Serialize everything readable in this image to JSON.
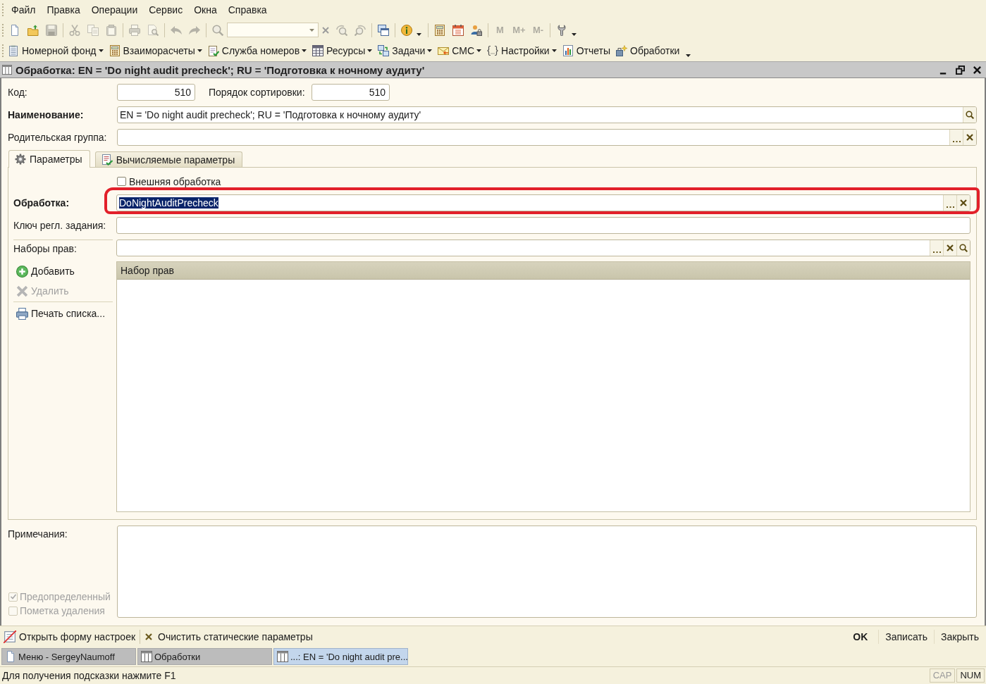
{
  "menu": [
    "Файл",
    "Правка",
    "Операции",
    "Сервис",
    "Окна",
    "Справка"
  ],
  "toolbar": [
    {
      "kind": "new",
      "disabled": false
    },
    {
      "kind": "open",
      "disabled": false
    },
    {
      "kind": "save",
      "disabled": true
    },
    {
      "kind": "separator"
    },
    {
      "kind": "cut",
      "disabled": true
    },
    {
      "kind": "copy",
      "disabled": true
    },
    {
      "kind": "paste",
      "disabled": true
    },
    {
      "kind": "separator"
    },
    {
      "kind": "print",
      "disabled": true
    },
    {
      "kind": "preview",
      "disabled": true
    },
    {
      "kind": "separator"
    },
    {
      "kind": "undo",
      "disabled": true
    },
    {
      "kind": "redo",
      "disabled": true
    },
    {
      "kind": "separator"
    },
    {
      "kind": "find",
      "disabled": true
    },
    {
      "kind": "search"
    },
    {
      "kind": "findnext",
      "disabled": true
    },
    {
      "kind": "findprev",
      "disabled": true
    },
    {
      "kind": "separator"
    },
    {
      "kind": "windows",
      "disabled": false
    },
    {
      "kind": "separator"
    },
    {
      "kind": "info",
      "disabled": false,
      "overflow": true
    },
    {
      "kind": "separator"
    },
    {
      "kind": "calculator",
      "disabled": false
    },
    {
      "kind": "calendar",
      "disabled": false
    },
    {
      "kind": "users",
      "disabled": false
    },
    {
      "kind": "separator"
    },
    {
      "kind": "text",
      "label": "M",
      "disabled": true
    },
    {
      "kind": "text",
      "label": "M+",
      "disabled": true
    },
    {
      "kind": "text",
      "label": "M-",
      "disabled": true
    },
    {
      "kind": "separator"
    },
    {
      "kind": "wrench",
      "disabled": false,
      "overflow": true
    }
  ],
  "navigation": {
    "items": [
      {
        "label": "Номерной фонд",
        "dropdown": true
      },
      {
        "label": "Взаиморасчеты",
        "dropdown": true
      },
      {
        "label": "Служба номеров",
        "dropdown": true
      },
      {
        "label": "Ресурсы",
        "dropdown": true
      },
      {
        "label": "Задачи",
        "dropdown": true
      },
      {
        "label": "СМС",
        "dropdown": true
      },
      {
        "label": "Настройки",
        "dropdown": true
      },
      {
        "label": "Отчеты",
        "dropdown": false
      },
      {
        "label": "Обработки",
        "dropdown": false
      }
    ],
    "overflow": true
  },
  "window": {
    "title": "Обработка: EN = 'Do night audit precheck'; RU = 'Подготовка к ночному аудиту'"
  },
  "form": {
    "code": {
      "label": "Код:",
      "value": "510",
      "required": false
    },
    "sort_order": {
      "label": "Порядок сортировки:",
      "value": "510",
      "required": false
    },
    "name": {
      "label": "Наименование:",
      "value": "EN = 'Do night audit precheck'; RU = 'Подготовка к ночному аудиту'",
      "required": true,
      "buttons": [
        {
          "kind": "open"
        }
      ]
    },
    "parent_group": {
      "label": "Родительская группа:",
      "required": false,
      "buttons": [
        {
          "kind": "select"
        },
        {
          "kind": "clear"
        }
      ]
    },
    "tabs": [
      {
        "label": "Параметры",
        "selected": true
      },
      {
        "label": "Вычисляемые параметры",
        "selected": false
      }
    ],
    "parameters": {
      "external": {
        "label": "Внешняя обработка",
        "checked": false
      },
      "processing": {
        "label": "Обработка:",
        "value": "DoNightAuditPrecheck",
        "required": true,
        "value_selected": true,
        "outlined": true,
        "buttons": [
          {
            "kind": "select"
          },
          {
            "kind": "clear"
          }
        ]
      },
      "job_key": {
        "label": "Ключ регл. задания:",
        "required": false
      },
      "rights_sets": {
        "label": "Наборы прав:",
        "required": false,
        "buttons": [
          {
            "kind": "select"
          },
          {
            "kind": "clear"
          },
          {
            "kind": "open"
          }
        ]
      },
      "commands": [
        {
          "kind": "add",
          "label": "Добавить",
          "disabled": false
        },
        {
          "kind": "delete",
          "label": "Удалить",
          "disabled": true
        },
        {
          "kind": "separator"
        },
        {
          "kind": "print",
          "label": "Печать списка...",
          "disabled": false
        }
      ],
      "table": {
        "columns": [
          "Набор прав"
        ]
      }
    },
    "notes": {
      "label": "Примечания:"
    },
    "flags": [
      {
        "label": "Предопределенный",
        "checked": true,
        "disabled": true
      },
      {
        "label": "Пометка удаления",
        "checked": false,
        "disabled": true
      }
    ]
  },
  "command_bar": {
    "left": [
      {
        "kind": "settings",
        "label": "Открыть форму настроек"
      },
      {
        "kind": "clear",
        "label": "Очистить статические параметры"
      }
    ],
    "right": [
      {
        "label": "OK",
        "default": true
      },
      {
        "label": "Записать",
        "default": false
      },
      {
        "label": "Закрыть",
        "default": false
      }
    ]
  },
  "window_tabs": [
    {
      "kind": "document",
      "label": "Меню - SergeyNaumoff",
      "selected": false
    },
    {
      "kind": "table",
      "label": "Обработки",
      "selected": false
    },
    {
      "kind": "table",
      "label": "...: EN = 'Do night audit pre...",
      "selected": true
    }
  ],
  "status_bar": {
    "hint": "Для получения подсказки нажмите F1",
    "indicators": [
      {
        "label": "CAP",
        "on": false
      },
      {
        "label": "NUM",
        "on": true
      }
    ]
  }
}
